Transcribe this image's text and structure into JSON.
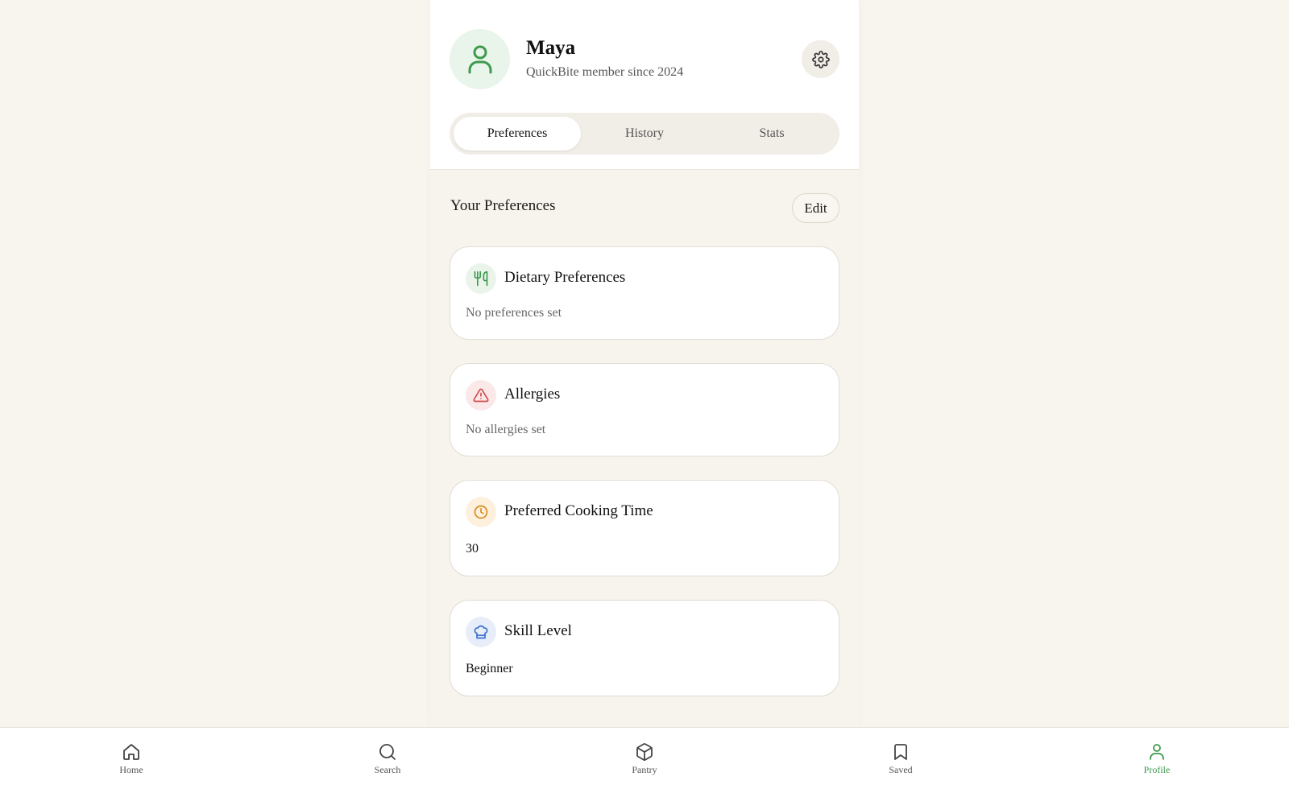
{
  "profile": {
    "name": "Maya",
    "member_since": "QuickBite member since 2024"
  },
  "tabs": [
    {
      "label": "Preferences",
      "active": true
    },
    {
      "label": "History",
      "active": false
    },
    {
      "label": "Stats",
      "active": false
    }
  ],
  "preferences": {
    "section_title": "Your Preferences",
    "edit_label": "Edit",
    "cards": [
      {
        "title": "Dietary Preferences",
        "value": "No preferences set",
        "icon": "utensils-icon",
        "accent": "#3d9a4b"
      },
      {
        "title": "Allergies",
        "value": "No allergies set",
        "icon": "warning-icon",
        "accent": "#d04a4a"
      },
      {
        "title": "Preferred Cooking Time",
        "value": "30",
        "icon": "clock-icon",
        "accent": "#d98a1c"
      },
      {
        "title": "Skill Level",
        "value": "Beginner",
        "icon": "chef-hat-icon",
        "accent": "#3a6fd0"
      }
    ]
  },
  "nav": {
    "items": [
      {
        "label": "Home",
        "icon": "home-icon",
        "active": false
      },
      {
        "label": "Search",
        "icon": "search-icon",
        "active": false
      },
      {
        "label": "Pantry",
        "icon": "box-icon",
        "active": false
      },
      {
        "label": "Saved",
        "icon": "bookmark-icon",
        "active": false
      },
      {
        "label": "Profile",
        "icon": "user-icon",
        "active": true
      }
    ]
  },
  "colors": {
    "accent_green": "#3d9a4b",
    "page_background": "#f8f4ee",
    "card_background": "#ffffff"
  }
}
